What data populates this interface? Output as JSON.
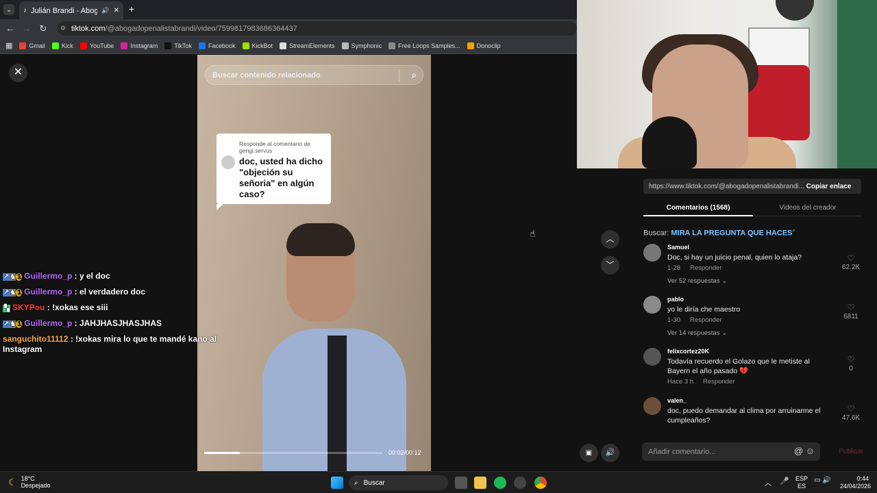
{
  "browser": {
    "tab_title": "Julián Brandi - Abogado 🙈",
    "tab_mute_icon": "speaker-icon",
    "url_domain": "tiktok.com",
    "url_path": "/@abogadopenalistabrandi/video/7599817983686364437",
    "bookmarks": [
      {
        "label": "Gmail",
        "color": "#ea4335"
      },
      {
        "label": "Kick",
        "color": "#53fc18"
      },
      {
        "label": "YouTube",
        "color": "#ff0000"
      },
      {
        "label": "Instagram",
        "color": "#d6249f"
      },
      {
        "label": "TikTok",
        "color": "#111111"
      },
      {
        "label": "Facebook",
        "color": "#1877f2"
      },
      {
        "label": "KickBot",
        "color": "#9be400"
      },
      {
        "label": "StreamElements",
        "color": "#dddddd"
      },
      {
        "label": "Symphonic",
        "color": "#bbbbbb"
      },
      {
        "label": "Free Loops Samples...",
        "color": "#888888"
      },
      {
        "label": "Donoclip",
        "color": "#f4a300"
      }
    ]
  },
  "video": {
    "search_placeholder": "Buscar contenido relacionado",
    "reply_header": "Responde al comentario de gengi.servus",
    "reply_question": "doc, usted ha dicho \"objeción su señoria\" en algún caso?",
    "time": "00:02/00:12",
    "progress": 0.2
  },
  "chat": [
    {
      "user": "Guillermo_p",
      "color": "#b56bff",
      "text": ": y el doc",
      "badges": true
    },
    {
      "user": "Guillermo_p",
      "color": "#b56bff",
      "text": ": el verdadero doc",
      "badges": true
    },
    {
      "user": "SKYPou",
      "color": "#ff3a3a",
      "text": ": !xokas ese siii",
      "badges": false
    },
    {
      "user": "Guillermo_p",
      "color": "#b56bff",
      "text": ": JAHJHASJHASJHAS",
      "badges": true
    },
    {
      "user": "sanguchito11112",
      "color": "#ffa94d",
      "text": ": !xokas mira lo que te mandé kano al Instagram",
      "badges": false
    }
  ],
  "panel": {
    "share_url": "https://www.tiktok.com/@abogadopenalistabrandi...",
    "copy_link": "Copiar enlace",
    "tab_comments": "Comentarios (1568)",
    "tab_videos": "Videos del creador",
    "search_prefix": "Buscar:",
    "search_term": "MIRA LA PREGUNTA QUE HACES",
    "comments": [
      {
        "name": "Samuel",
        "text": "Doc, si hay un juicio penal, quien lo ataja?",
        "meta": "1-28",
        "reply": "Responder",
        "likes": "62.2K",
        "replies": "Ver 52 respuestas ⌄"
      },
      {
        "name": "pablo",
        "text": "yo le diría che maestro",
        "meta": "1-30",
        "reply": "Responder",
        "likes": "6811",
        "replies": "Ver 14 respuestas ⌄"
      },
      {
        "name": "felixcortez20K",
        "text": "Todavía recuerdo el Golazo que le metiste al Bayern el año pasado 💔",
        "meta": "Hace 3 h",
        "reply": "Responder",
        "likes": "0",
        "replies": ""
      },
      {
        "name": "valen_",
        "text": "doc, puedo demandar al clima por arruinarme el cumpleaños?",
        "meta": "",
        "reply": "",
        "likes": "47.6K",
        "replies": ""
      }
    ],
    "comment_placeholder": "Añadir comentario...",
    "publish": "Publicar"
  },
  "taskbar": {
    "weather_temp": "18°C",
    "weather_desc": "Despejado",
    "search": "Buscar",
    "lang1": "ESP",
    "lang2": "ES",
    "time": "0:44",
    "date": "24/04/2026"
  }
}
